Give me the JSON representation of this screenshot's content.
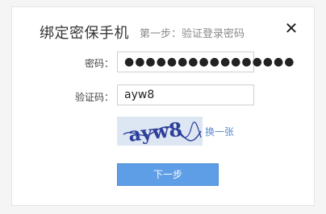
{
  "dialog": {
    "title": "绑定密保手机",
    "step": "第一步：验证登录密码",
    "close_icon": "close-icon"
  },
  "password": {
    "label": "密码：",
    "value": "●●●●●●●●●●●●●●●●"
  },
  "captcha": {
    "label": "验证码：",
    "value": "ayw8",
    "image_text": "ayw8",
    "refresh_label": "换一张"
  },
  "actions": {
    "next_label": "下一步"
  },
  "colors": {
    "accent": "#5d9ee7",
    "link": "#5a8ad0",
    "captcha_bg": "#dde6f3",
    "captcha_ink": "#2e3f9a"
  }
}
